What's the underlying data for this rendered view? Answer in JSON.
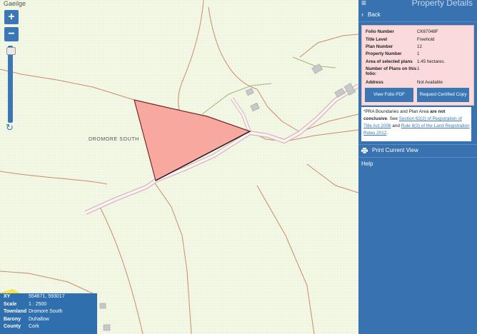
{
  "map": {
    "language_link": "Gaeilge",
    "zoom_in": "+",
    "zoom_out": "−",
    "refresh_icon": "↻",
    "townland_label": "DROMORE SOUTH"
  },
  "info": {
    "rows": [
      {
        "key": "XY",
        "value": "554671, 593017"
      },
      {
        "key": "Scale",
        "value": "1 : 2500"
      },
      {
        "key": "Townland",
        "value": "Dromore South"
      },
      {
        "key": "Barony",
        "value": "Duhallow"
      },
      {
        "key": "County",
        "value": "Cork"
      }
    ]
  },
  "panel": {
    "menu_icon": "≡",
    "title": "Property Details",
    "back_label": "Back",
    "details": [
      {
        "key": "Folio Number",
        "value": "CK67048F"
      },
      {
        "key": "Title Level",
        "value": "Freehold"
      },
      {
        "key": "Plan Number",
        "value": "12"
      },
      {
        "key": "Property Number",
        "value": "1"
      },
      {
        "key": "Area of selected plans",
        "value": "1.45 hectares."
      },
      {
        "key": "Number of Plans on this folio:",
        "value": "1"
      },
      {
        "key": "Address",
        "value": "Not Available"
      }
    ],
    "view_folio_button": "View Folio PDF",
    "certified_copy_button": "Request Certified Copy",
    "note": {
      "prefix": "*PRA Boundaries and Plan Area ",
      "bold": "are not conclusive",
      "middle": ". See ",
      "link1": "Section 62(2) of Registration of Title Act 2006",
      "and": " and ",
      "link2": "Rule 8(3) of the Land Registration Rules 2012",
      "suffix": "."
    },
    "print_label": "Print Current View",
    "help_label": "Help"
  },
  "colors": {
    "panel_blue": "#3872b0",
    "parcel_fill": "#f7a9a0",
    "details_bg": "#fadada"
  }
}
